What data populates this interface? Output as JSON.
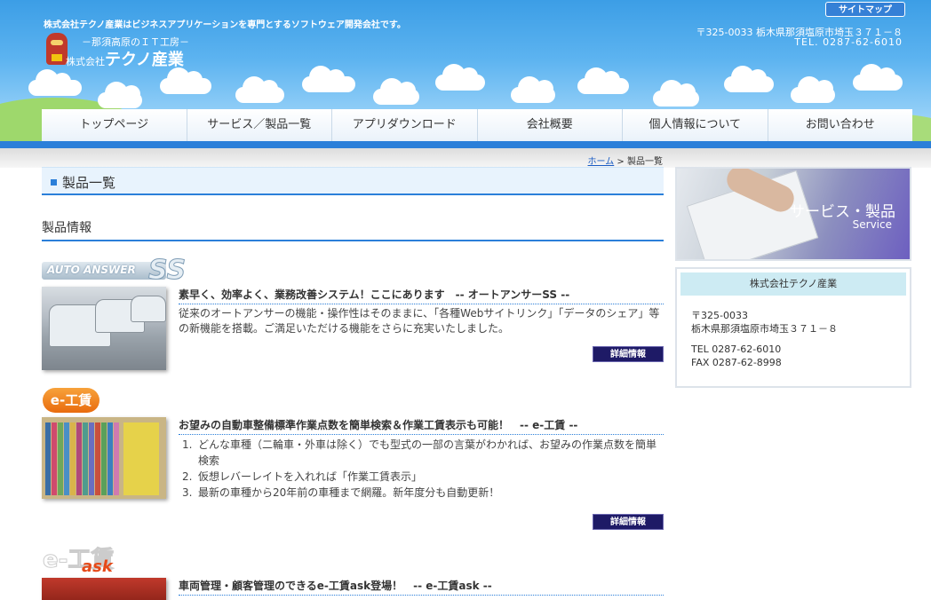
{
  "header": {
    "tagline": "株式会社テクノ産業はビジネスアプリケーションを専門とするソフトウェア開発会社です。",
    "logo_sub": "－那須高原のＩＴ工房－",
    "logo_prefix": "株式会社",
    "logo_name": "テクノ産業",
    "sitemap_label": "サイトマップ",
    "address_line": "〒325-0033 栃木県那須塩原市埼玉３７１－８",
    "phone_line": "TEL. 0287-62-6010"
  },
  "nav": {
    "items": [
      "トップページ",
      "サービス／製品一覧",
      "アプリダウンロード",
      "会社概要",
      "個人情報について",
      "お問い合わせ"
    ]
  },
  "breadcrumb": {
    "home": "ホーム",
    "separator": " > ",
    "current": "製品一覧"
  },
  "main": {
    "page_title": "製品一覧",
    "section_title": "製品情報",
    "detail_label": "詳細情報",
    "products": [
      {
        "logo_text": "AUTO ANSWER",
        "logo_suffix": "SS",
        "title": "素早く、効率よく、業務改善システム！ここにあります　-- オートアンサーSS --",
        "desc": "従来のオートアンサーの機能・操作性はそのままに、「各種Webサイトリンク」「データのシェア」等の新機能を搭載。ご満足いただける機能をさらに充実いたしました。"
      },
      {
        "logo_text": "e-工賃",
        "title": "お望みの自動車整備標準作業点数を簡単検索＆作業工賃表示も可能！　-- e-工賃 --",
        "list": [
          {
            "num": "1.",
            "text": "どんな車種（二輪車・外車は除く）でも型式の一部の言葉がわかれば、お望みの作業点数を簡単検索"
          },
          {
            "num": "2.",
            "text": "仮想レバーレイトを入れれば「作業工賃表示」"
          },
          {
            "num": "3.",
            "text": "最新の車種から20年前の車種まで網羅。新年度分も自動更新！"
          }
        ]
      },
      {
        "logo_text": "e-工賃",
        "logo_suffix": "ask",
        "title": "車両管理・顧客管理のできるe-工賃ask登場！　-- e-工賃ask --"
      }
    ]
  },
  "sidebar": {
    "banner_title": "サービス・製品",
    "banner_en": "Service",
    "company": {
      "name": "株式会社テクノ産業",
      "postal": "〒325-0033",
      "address": "栃木県那須塩原市埼玉３７１－８",
      "tel": "TEL 0287-62-6010",
      "fax": "FAX 0287-62-8998"
    }
  }
}
